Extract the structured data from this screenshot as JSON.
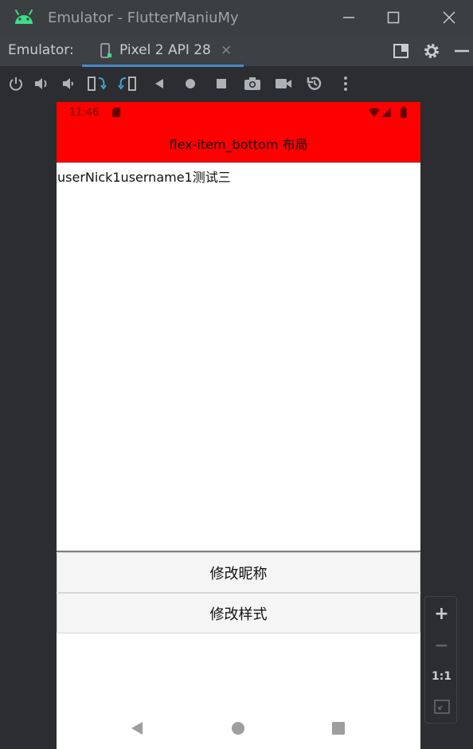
{
  "window": {
    "title": "Emulator - FlutterManiuMy",
    "controls": [
      "minimize-icon",
      "maximize-icon",
      "close-icon"
    ]
  },
  "tabbar": {
    "label": "Emulator:",
    "tab_label": "Pixel 2 API 28",
    "tab_close": "×",
    "right_icons": [
      "dock-icon",
      "gear-icon",
      "minimize-panel-icon"
    ]
  },
  "toolbar": {
    "icons": [
      "power-icon",
      "volume-up-icon",
      "volume-down-icon",
      "rotate-left-icon",
      "rotate-right-icon",
      "back-icon",
      "home-icon",
      "overview-icon",
      "screenshot-icon",
      "screenrecord-icon",
      "snapshot-icon",
      "more-icon"
    ]
  },
  "device": {
    "status_time": "11:46",
    "app_title": "flex-item_bottom 布局",
    "content_text": "userNick1username1测试三",
    "buttons": [
      "修改昵称",
      "修改样式"
    ],
    "accent_color": "#ff0000"
  },
  "zoom": {
    "plus": "+",
    "minus": "−",
    "one_to_one": "1:1"
  }
}
